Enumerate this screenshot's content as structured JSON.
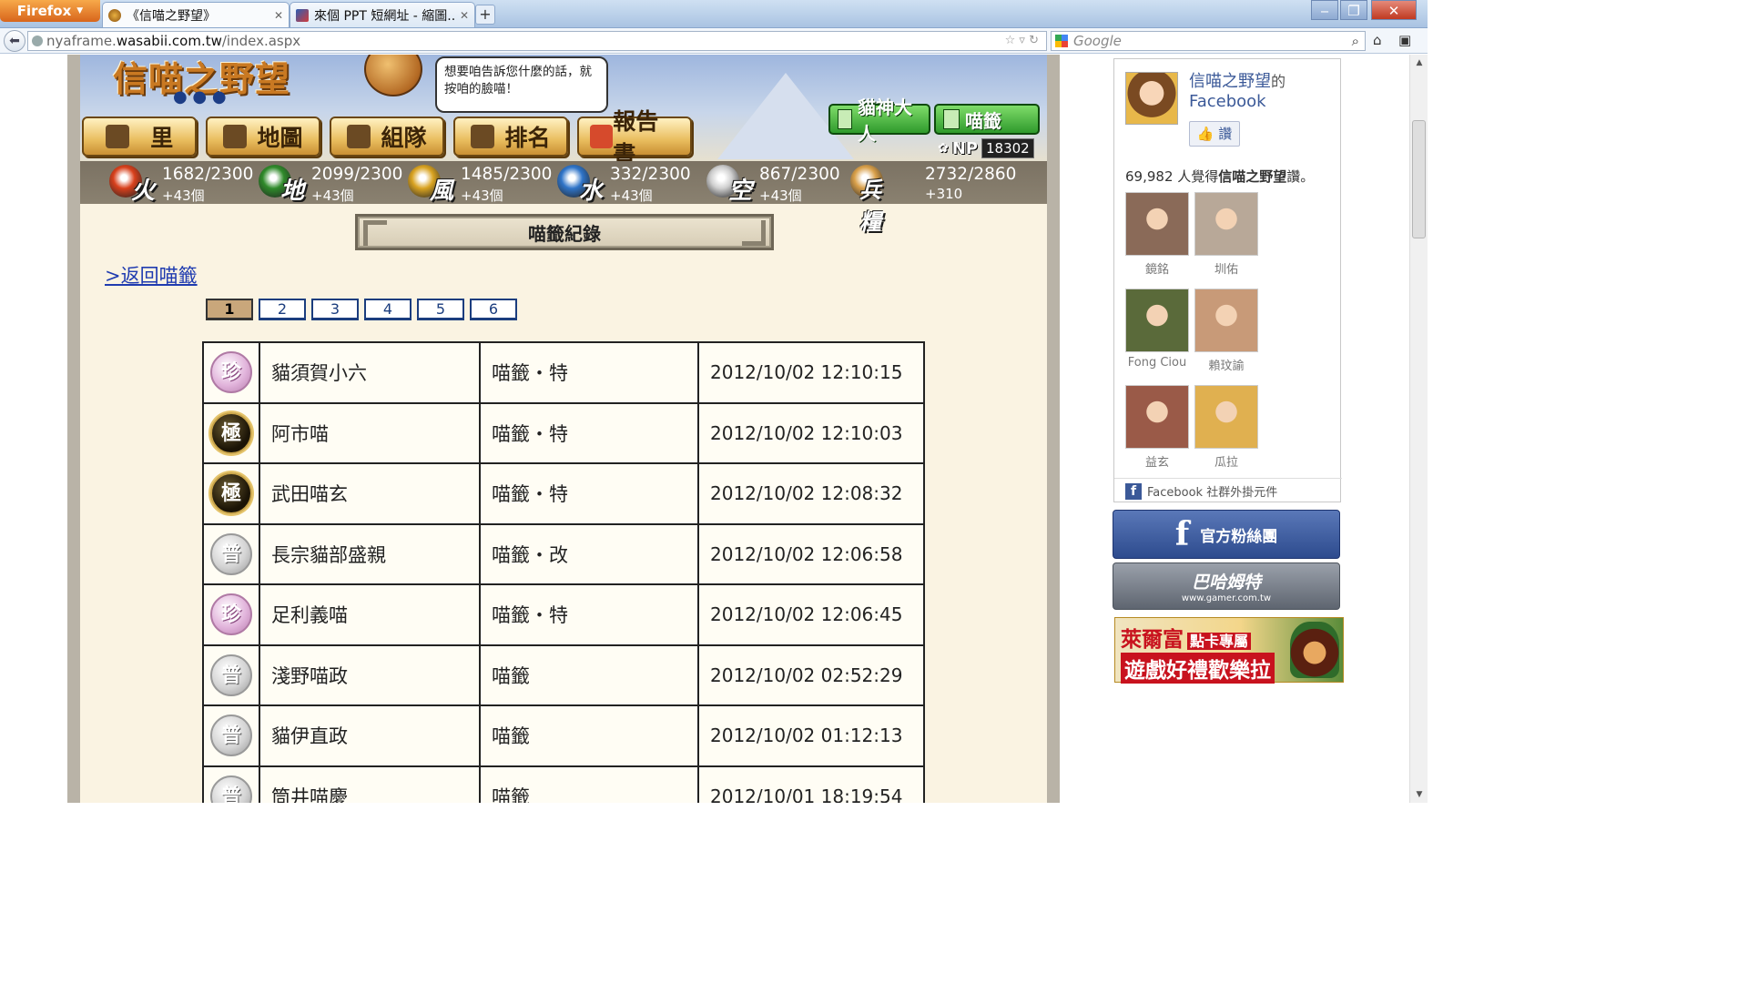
{
  "browser": {
    "menu_label": "Firefox",
    "tabs": [
      {
        "title": "《信喵之野望》",
        "active": true
      },
      {
        "title": "來個 PPT 短網址 - 縮圖...",
        "active": false
      }
    ],
    "new_tab": "+",
    "url_prefix": "nyaframe.",
    "url_host": "wasabii.com.tw",
    "url_path": "/index.aspx",
    "search_placeholder": "Google"
  },
  "game": {
    "logo": "信喵之野望",
    "speech": "想要咱告訴您什麼的話，就按咱的臉喵！",
    "nav": [
      "里",
      "地圖",
      "組隊",
      "排名",
      "報告書"
    ],
    "green_buttons": [
      "貓神大人",
      "喵籤"
    ],
    "np_label": "NP",
    "np_value": "18302",
    "resources": [
      {
        "name": "火",
        "amount": "1682/2300",
        "gain": "+43個",
        "color": "#d8401c"
      },
      {
        "name": "地",
        "amount": "2099/2300",
        "gain": "+43個",
        "color": "#2f8a2a"
      },
      {
        "name": "風",
        "amount": "1485/2300",
        "gain": "+43個",
        "color": "#d9a321"
      },
      {
        "name": "水",
        "amount": "332/2300",
        "gain": "+43個",
        "color": "#2f74c8"
      },
      {
        "name": "空",
        "amount": "867/2300",
        "gain": "+43個",
        "color": "#cfcfcf"
      },
      {
        "name": "兵糧",
        "amount": "2732/2860",
        "gain": "+310",
        "color": "#d9a04a"
      }
    ],
    "section_title": "喵籤紀錄",
    "back_link": ">返回喵籤",
    "pages": [
      "1",
      "2",
      "3",
      "4",
      "5",
      "6"
    ],
    "active_page": "1",
    "records": [
      {
        "rarity": "珍",
        "rarity_class": "rare",
        "name": "貓須賀小六",
        "type": "喵籤・特",
        "time": "2012/10/02 12:10:15"
      },
      {
        "rarity": "極",
        "rarity_class": "extreme",
        "name": "阿市喵",
        "type": "喵籤・特",
        "time": "2012/10/02 12:10:03"
      },
      {
        "rarity": "極",
        "rarity_class": "extreme",
        "name": "武田喵玄",
        "type": "喵籤・特",
        "time": "2012/10/02 12:08:32"
      },
      {
        "rarity": "普",
        "rarity_class": "common",
        "name": "長宗貓部盛親",
        "type": "喵籤・改",
        "time": "2012/10/02 12:06:58"
      },
      {
        "rarity": "珍",
        "rarity_class": "rare",
        "name": "足利義喵",
        "type": "喵籤・特",
        "time": "2012/10/02 12:06:45"
      },
      {
        "rarity": "普",
        "rarity_class": "common",
        "name": "淺野喵政",
        "type": "喵籤",
        "time": "2012/10/02 02:52:29"
      },
      {
        "rarity": "普",
        "rarity_class": "common",
        "name": "貓伊直政",
        "type": "喵籤",
        "time": "2012/10/02 01:12:13"
      },
      {
        "rarity": "普",
        "rarity_class": "common",
        "name": "筒井喵慶",
        "type": "喵籤",
        "time": "2012/10/01 18:19:54"
      }
    ]
  },
  "facebook": {
    "page_name": "信喵之野望",
    "page_suffix": "的",
    "platform": "Facebook",
    "like_label": "讚",
    "like_count": "69,982",
    "like_count_text_pre": " 人覺得",
    "like_count_page": "信喵之野望",
    "like_count_text_post": "讚。",
    "fans": [
      {
        "name": "鏡銘",
        "color": "#8a6a58"
      },
      {
        "name": "圳佑",
        "color": "#b8a898"
      },
      {
        "name": "Fong Ciou",
        "color": "#5a6a3a"
      },
      {
        "name": "賴玟諭",
        "color": "#c89a78"
      },
      {
        "name": "益玄",
        "color": "#9a5a48"
      },
      {
        "name": "瓜拉",
        "color": "#e0b050"
      }
    ],
    "footer": "Facebook 社群外掛元件"
  },
  "banners": {
    "fan_page": "官方粉絲團",
    "gamer_name": "巴哈姆特",
    "gamer_url": "www.gamer.com.tw",
    "ad_line1": "萊爾富",
    "ad_tag": "點卡專屬",
    "ad_line2": "遊戲好禮歡樂拉"
  }
}
